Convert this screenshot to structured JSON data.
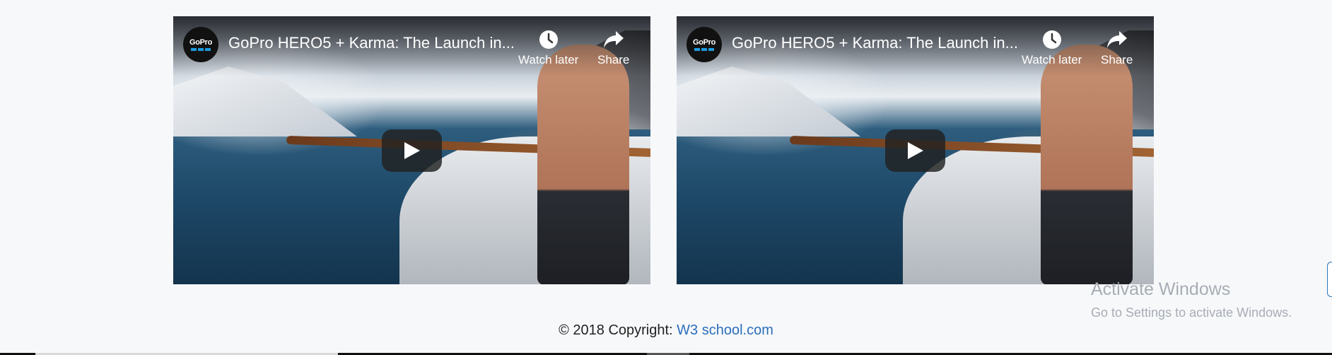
{
  "videos": [
    {
      "channel_logo": "GoPro",
      "title": "GoPro HERO5 + Karma: The Launch in...",
      "watch_later_label": "Watch later",
      "share_label": "Share",
      "icons": {
        "watch_later": "clock-icon",
        "share": "share-arrow-icon",
        "play": "play-icon"
      }
    },
    {
      "channel_logo": "GoPro",
      "title": "GoPro HERO5 + Karma: The Launch in...",
      "watch_later_label": "Watch later",
      "share_label": "Share",
      "icons": {
        "watch_later": "clock-icon",
        "share": "share-arrow-icon",
        "play": "play-icon"
      }
    }
  ],
  "footer": {
    "copyright": "© 2018 Copyright: ",
    "link_text": "W3 school.com"
  },
  "windows_watermark": {
    "title": "Activate Windows",
    "subtitle": "Go to Settings to activate Windows."
  },
  "colors": {
    "background": "#f7f8fa",
    "link": "#2a6ebb",
    "logo_accent": "#1e9be0",
    "watermark": "#a7adb4"
  }
}
